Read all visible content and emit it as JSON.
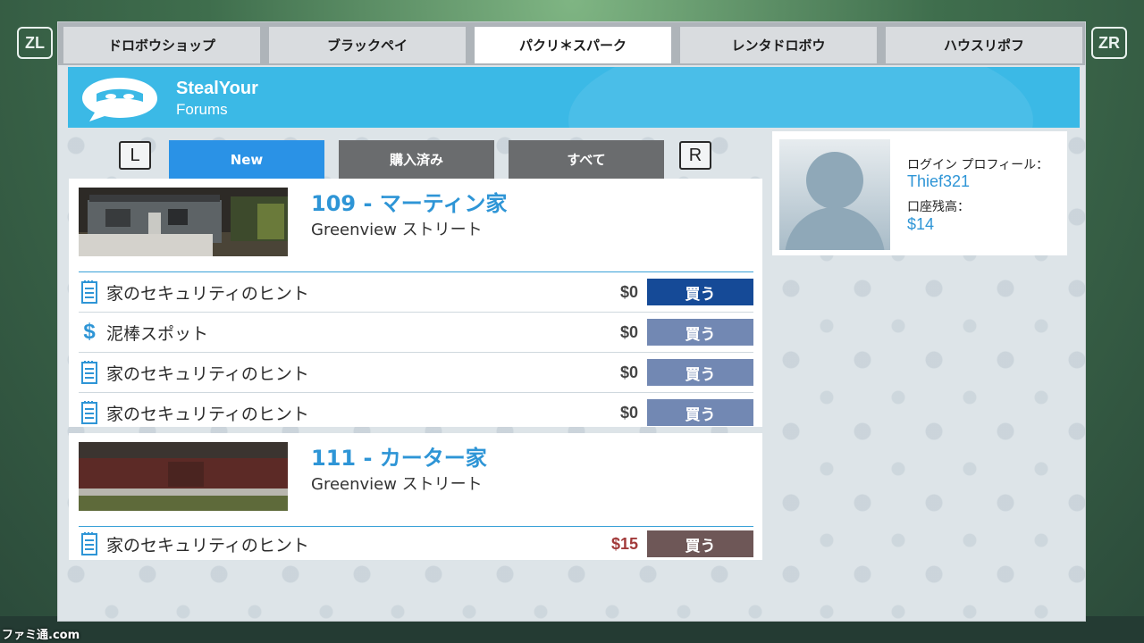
{
  "hints": {
    "left_trigger": "ZL",
    "right_trigger": "ZR",
    "left_shoulder": "L",
    "right_shoulder": "R"
  },
  "top_tabs": [
    {
      "label": "ドロボウショップ",
      "active": false
    },
    {
      "label": "ブラックペイ",
      "active": false
    },
    {
      "label": "パクリ＊スパーク",
      "active": true
    },
    {
      "label": "レンタドロボウ",
      "active": false
    },
    {
      "label": "ハウスリポフ",
      "active": false
    }
  ],
  "banner": {
    "title": "StealYour",
    "subtitle": "Forums",
    "icon": "mask-speech-bubble-icon"
  },
  "sub_tabs": [
    {
      "label": "New",
      "active": true
    },
    {
      "label": "購入済み",
      "active": false
    },
    {
      "label": "すべて",
      "active": false
    }
  ],
  "listings": [
    {
      "title": "109 - マーティン家",
      "street": "Greenview ストリート",
      "items": [
        {
          "icon": "notepad-icon",
          "label": "家のセキュリティのヒント",
          "price": "$0",
          "buy": "買う",
          "state": "selected"
        },
        {
          "icon": "dollar-icon",
          "label": "泥棒スポット",
          "price": "$0",
          "buy": "買う",
          "state": "normal"
        },
        {
          "icon": "notepad-icon",
          "label": "家のセキュリティのヒント",
          "price": "$0",
          "buy": "買う",
          "state": "normal"
        },
        {
          "icon": "notepad-icon",
          "label": "家のセキュリティのヒント",
          "price": "$0",
          "buy": "買う",
          "state": "normal"
        }
      ]
    },
    {
      "title": "111 - カーター家",
      "street": "Greenview ストリート",
      "items": [
        {
          "icon": "notepad-icon",
          "label": "家のセキュリティのヒント",
          "price": "$15",
          "buy": "買う",
          "state": "unaffordable"
        }
      ]
    }
  ],
  "profile": {
    "login_label": "ログイン プロフィール：",
    "username": "Thief321",
    "balance_label": "口座残高：",
    "balance": "$14"
  },
  "watermark": "ファミ通.com",
  "colors": {
    "accent_blue": "#3bb9e6",
    "link_blue": "#2e95d6",
    "selected_button": "#154a97",
    "price_red": "#a23a3a"
  }
}
